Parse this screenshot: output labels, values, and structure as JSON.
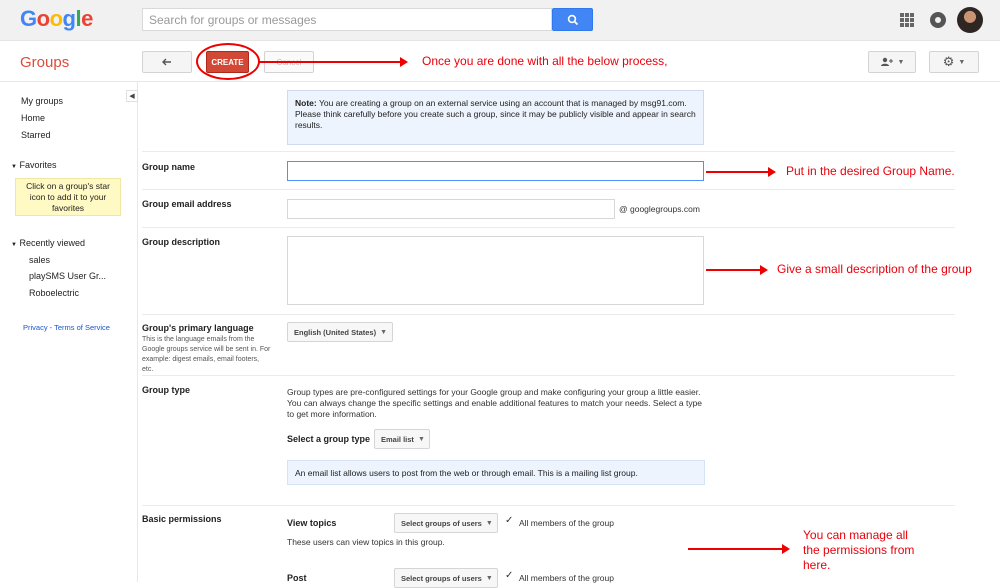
{
  "header": {
    "logo_letters": [
      "G",
      "o",
      "o",
      "g",
      "l",
      "e"
    ],
    "logo_colors": [
      "#4285f4",
      "#ea4335",
      "#fbbc05",
      "#4285f4",
      "#34a853",
      "#ea4335"
    ],
    "search_placeholder": "Search for groups or messages",
    "search_btn_color": "#4285f4"
  },
  "toolbar": {
    "title": "Groups",
    "create_label": "CREATE",
    "cancel_label": "Cancel"
  },
  "sidebar": {
    "items": [
      "My groups",
      "Home",
      "Starred"
    ],
    "favorites_label": "Favorites",
    "favorites_hint": "Click on a group's star icon to add it to your favorites",
    "recent_label": "Recently viewed",
    "recent_items": [
      "sales",
      "playSMS User Gr...",
      "Roboelectric"
    ],
    "privacy_terms": "Privacy - Terms of Service"
  },
  "form": {
    "note_bold": "Note:",
    "note_text": "You are creating a group on an external service using an account that is managed by msg91.com. Please think carefully before you create such a group, since it may be publicly visible and appear in search results.",
    "group_name_label": "Group name",
    "group_email_label": "Group email address",
    "email_suffix": "@ googlegroups.com",
    "group_desc_label": "Group description",
    "primary_lang_label": "Group's primary language",
    "primary_lang_help": "This is the language emails from the Google groups service will be sent in. For example: digest emails, email footers, etc.",
    "language_value": "English (United States)",
    "group_type_label": "Group type",
    "group_type_desc": "Group types are pre-configured settings for your Google group and make configuring your group a little easier. You can always change the specific settings and enable additional features to match your needs. Select a type to get more information.",
    "select_type_label": "Select a group type",
    "type_value": "Email list",
    "type_info": "An email list allows users to post from the web or through email. This is a mailing list group.",
    "basic_permissions_label": "Basic permissions",
    "view_topics_label": "View topics",
    "view_topics_dropdown": "Select groups of users",
    "view_topics_value": "All members of the group",
    "view_topics_help": "These users can view topics in this group.",
    "post_label": "Post",
    "post_dropdown": "Select groups of users",
    "post_value": "All members of the group"
  },
  "annotations": {
    "create_note": "Once you are done with all the below process,",
    "name_note": "Put in the desired Group Name.",
    "desc_note": "Give a small description of the group",
    "perm_note_lines": [
      "You can manage all",
      "the permissions from",
      "here."
    ],
    "color": "#e8000b"
  }
}
